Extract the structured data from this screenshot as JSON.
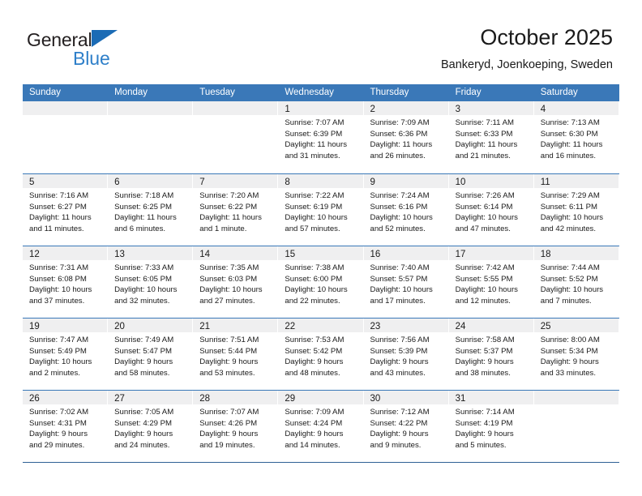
{
  "brand": {
    "name_part1": "General",
    "name_part2": "Blue",
    "triangle_color": "#1b6bb5",
    "blue_text_color": "#2e7fc9"
  },
  "header": {
    "title": "October 2025",
    "subtitle": "Bankeryd, Joenkoeping, Sweden"
  },
  "theme": {
    "header_blue": "#3a78b8",
    "day_head_gray": "#efeff0",
    "text_color": "#1a1a1a"
  },
  "calendar": {
    "weekdays": [
      "Sunday",
      "Monday",
      "Tuesday",
      "Wednesday",
      "Thursday",
      "Friday",
      "Saturday"
    ],
    "weeks": [
      [
        {
          "day": "",
          "lines": []
        },
        {
          "day": "",
          "lines": []
        },
        {
          "day": "",
          "lines": []
        },
        {
          "day": "1",
          "lines": [
            "Sunrise: 7:07 AM",
            "Sunset: 6:39 PM",
            "Daylight: 11 hours",
            "and 31 minutes."
          ]
        },
        {
          "day": "2",
          "lines": [
            "Sunrise: 7:09 AM",
            "Sunset: 6:36 PM",
            "Daylight: 11 hours",
            "and 26 minutes."
          ]
        },
        {
          "day": "3",
          "lines": [
            "Sunrise: 7:11 AM",
            "Sunset: 6:33 PM",
            "Daylight: 11 hours",
            "and 21 minutes."
          ]
        },
        {
          "day": "4",
          "lines": [
            "Sunrise: 7:13 AM",
            "Sunset: 6:30 PM",
            "Daylight: 11 hours",
            "and 16 minutes."
          ]
        }
      ],
      [
        {
          "day": "5",
          "lines": [
            "Sunrise: 7:16 AM",
            "Sunset: 6:27 PM",
            "Daylight: 11 hours",
            "and 11 minutes."
          ]
        },
        {
          "day": "6",
          "lines": [
            "Sunrise: 7:18 AM",
            "Sunset: 6:25 PM",
            "Daylight: 11 hours",
            "and 6 minutes."
          ]
        },
        {
          "day": "7",
          "lines": [
            "Sunrise: 7:20 AM",
            "Sunset: 6:22 PM",
            "Daylight: 11 hours",
            "and 1 minute."
          ]
        },
        {
          "day": "8",
          "lines": [
            "Sunrise: 7:22 AM",
            "Sunset: 6:19 PM",
            "Daylight: 10 hours",
            "and 57 minutes."
          ]
        },
        {
          "day": "9",
          "lines": [
            "Sunrise: 7:24 AM",
            "Sunset: 6:16 PM",
            "Daylight: 10 hours",
            "and 52 minutes."
          ]
        },
        {
          "day": "10",
          "lines": [
            "Sunrise: 7:26 AM",
            "Sunset: 6:14 PM",
            "Daylight: 10 hours",
            "and 47 minutes."
          ]
        },
        {
          "day": "11",
          "lines": [
            "Sunrise: 7:29 AM",
            "Sunset: 6:11 PM",
            "Daylight: 10 hours",
            "and 42 minutes."
          ]
        }
      ],
      [
        {
          "day": "12",
          "lines": [
            "Sunrise: 7:31 AM",
            "Sunset: 6:08 PM",
            "Daylight: 10 hours",
            "and 37 minutes."
          ]
        },
        {
          "day": "13",
          "lines": [
            "Sunrise: 7:33 AM",
            "Sunset: 6:05 PM",
            "Daylight: 10 hours",
            "and 32 minutes."
          ]
        },
        {
          "day": "14",
          "lines": [
            "Sunrise: 7:35 AM",
            "Sunset: 6:03 PM",
            "Daylight: 10 hours",
            "and 27 minutes."
          ]
        },
        {
          "day": "15",
          "lines": [
            "Sunrise: 7:38 AM",
            "Sunset: 6:00 PM",
            "Daylight: 10 hours",
            "and 22 minutes."
          ]
        },
        {
          "day": "16",
          "lines": [
            "Sunrise: 7:40 AM",
            "Sunset: 5:57 PM",
            "Daylight: 10 hours",
            "and 17 minutes."
          ]
        },
        {
          "day": "17",
          "lines": [
            "Sunrise: 7:42 AM",
            "Sunset: 5:55 PM",
            "Daylight: 10 hours",
            "and 12 minutes."
          ]
        },
        {
          "day": "18",
          "lines": [
            "Sunrise: 7:44 AM",
            "Sunset: 5:52 PM",
            "Daylight: 10 hours",
            "and 7 minutes."
          ]
        }
      ],
      [
        {
          "day": "19",
          "lines": [
            "Sunrise: 7:47 AM",
            "Sunset: 5:49 PM",
            "Daylight: 10 hours",
            "and 2 minutes."
          ]
        },
        {
          "day": "20",
          "lines": [
            "Sunrise: 7:49 AM",
            "Sunset: 5:47 PM",
            "Daylight: 9 hours",
            "and 58 minutes."
          ]
        },
        {
          "day": "21",
          "lines": [
            "Sunrise: 7:51 AM",
            "Sunset: 5:44 PM",
            "Daylight: 9 hours",
            "and 53 minutes."
          ]
        },
        {
          "day": "22",
          "lines": [
            "Sunrise: 7:53 AM",
            "Sunset: 5:42 PM",
            "Daylight: 9 hours",
            "and 48 minutes."
          ]
        },
        {
          "day": "23",
          "lines": [
            "Sunrise: 7:56 AM",
            "Sunset: 5:39 PM",
            "Daylight: 9 hours",
            "and 43 minutes."
          ]
        },
        {
          "day": "24",
          "lines": [
            "Sunrise: 7:58 AM",
            "Sunset: 5:37 PM",
            "Daylight: 9 hours",
            "and 38 minutes."
          ]
        },
        {
          "day": "25",
          "lines": [
            "Sunrise: 8:00 AM",
            "Sunset: 5:34 PM",
            "Daylight: 9 hours",
            "and 33 minutes."
          ]
        }
      ],
      [
        {
          "day": "26",
          "lines": [
            "Sunrise: 7:02 AM",
            "Sunset: 4:31 PM",
            "Daylight: 9 hours",
            "and 29 minutes."
          ]
        },
        {
          "day": "27",
          "lines": [
            "Sunrise: 7:05 AM",
            "Sunset: 4:29 PM",
            "Daylight: 9 hours",
            "and 24 minutes."
          ]
        },
        {
          "day": "28",
          "lines": [
            "Sunrise: 7:07 AM",
            "Sunset: 4:26 PM",
            "Daylight: 9 hours",
            "and 19 minutes."
          ]
        },
        {
          "day": "29",
          "lines": [
            "Sunrise: 7:09 AM",
            "Sunset: 4:24 PM",
            "Daylight: 9 hours",
            "and 14 minutes."
          ]
        },
        {
          "day": "30",
          "lines": [
            "Sunrise: 7:12 AM",
            "Sunset: 4:22 PM",
            "Daylight: 9 hours",
            "and 9 minutes."
          ]
        },
        {
          "day": "31",
          "lines": [
            "Sunrise: 7:14 AM",
            "Sunset: 4:19 PM",
            "Daylight: 9 hours",
            "and 5 minutes."
          ]
        },
        {
          "day": "",
          "lines": []
        }
      ]
    ]
  }
}
